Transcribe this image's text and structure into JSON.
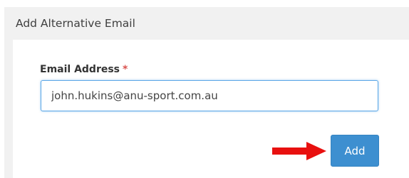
{
  "panel": {
    "title": "Add Alternative Email"
  },
  "form": {
    "email_label": "Email Address",
    "required_marker": "*",
    "email_value": "john.hukins@anu-sport.com.au",
    "submit_label": "Add"
  },
  "annotation": {
    "arrow_icon": "red-arrow-right-icon",
    "arrow_color": "#e8100f"
  },
  "colors": {
    "button_bg": "#3d8fd0",
    "input_focus_border": "#5aa6e6",
    "required_star": "#d9534f"
  }
}
